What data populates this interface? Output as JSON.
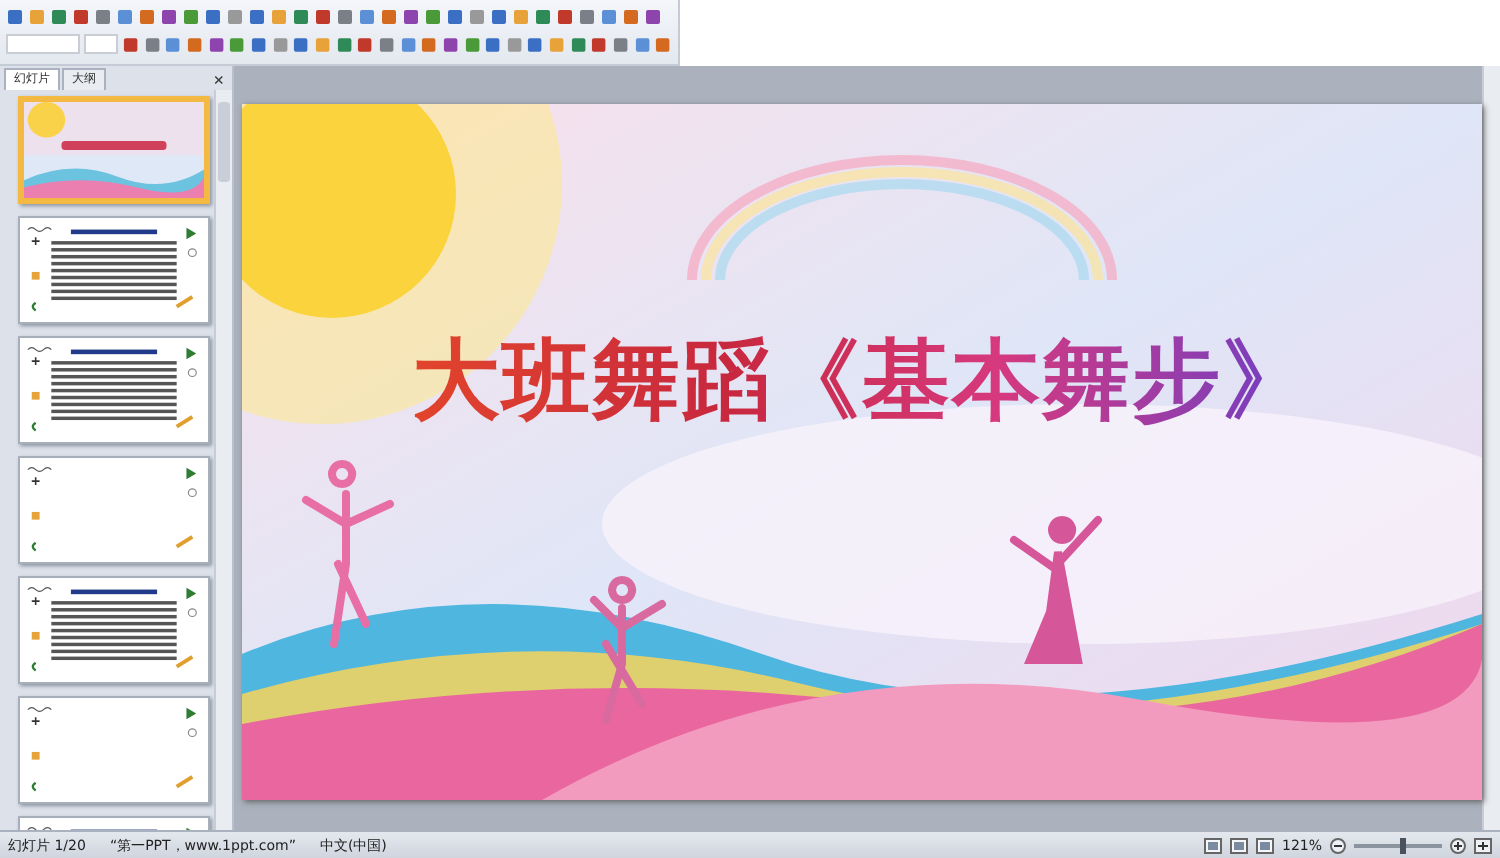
{
  "panel": {
    "tabs": [
      {
        "label": "幻灯片",
        "selected": true
      },
      {
        "label": "大纲",
        "selected": false
      }
    ],
    "close": "×"
  },
  "slides": [
    {
      "kind": "title",
      "selected": true
    },
    {
      "kind": "text",
      "selected": false
    },
    {
      "kind": "text",
      "selected": false
    },
    {
      "kind": "blank",
      "selected": false
    },
    {
      "kind": "text",
      "selected": false
    },
    {
      "kind": "blank",
      "selected": false
    },
    {
      "kind": "text",
      "selected": false
    }
  ],
  "slide": {
    "title": "大班舞蹈《基本舞步》"
  },
  "status_bar": {
    "slide_count": "幻灯片 1/20",
    "theme": "“第一PPT，www.1ppt.com”",
    "language": "中文(中国)",
    "zoom": "121%",
    "zoom_level": {
      "level": 0.55
    }
  }
}
